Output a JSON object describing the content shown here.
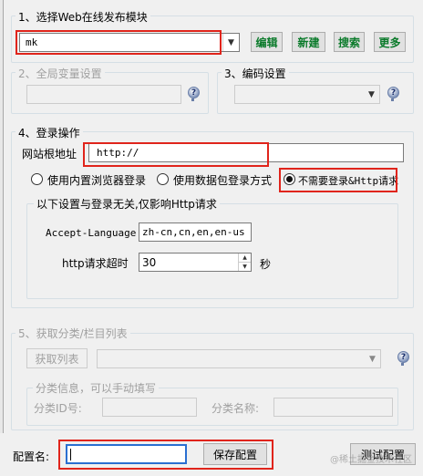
{
  "section1": {
    "title": "1、选择Web在线发布模块",
    "module_value": "mk",
    "buttons": {
      "edit": "编辑",
      "new": "新建",
      "search": "搜索",
      "more": "更多"
    }
  },
  "section2": {
    "title": "2、全局变量设置",
    "help_icon": "?"
  },
  "section3": {
    "title": "3、编码设置",
    "help_icon": "?"
  },
  "section4": {
    "title": "4、登录操作",
    "root_label": "网站根地址",
    "root_value": "http://",
    "radio_builtin": "使用内置浏览器登录",
    "radio_packet": "使用数据包登录方式",
    "radio_none": "不需要登录&Http请求",
    "sub_title": "以下设置与登录无关,仅影响Http请求",
    "accept_language_label": "Accept-Language",
    "accept_language_value": "zh-cn,cn,en,en-us",
    "timeout_label": "http请求超时",
    "timeout_value": "30",
    "timeout_unit": "秒"
  },
  "section5": {
    "title": "5、获取分类/栏目列表",
    "get_list_button": "获取列表",
    "help_icon": "?",
    "manual_title": "分类信息，可以手动填写",
    "category_id_label": "分类ID号:",
    "category_name_label": "分类名称:"
  },
  "footer": {
    "config_name_label": "配置名:",
    "config_name_value": "",
    "save_button": "保存配置",
    "test_button": "测试配置",
    "watermark": "@稀土掘金技术社区"
  }
}
